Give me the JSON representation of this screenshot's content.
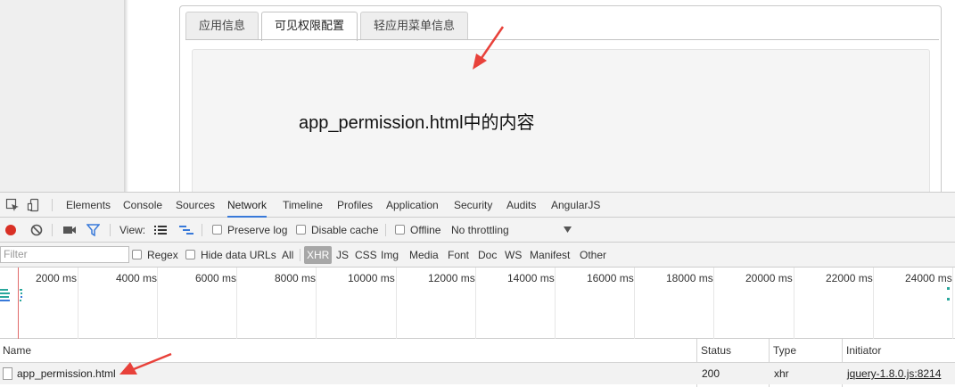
{
  "page": {
    "tabs": [
      {
        "label": "应用信息",
        "active": false
      },
      {
        "label": "可见权限配置",
        "active": true
      },
      {
        "label": "轻应用菜单信息",
        "active": false
      }
    ],
    "content_text": "app_permission.html中的内容"
  },
  "devtools": {
    "tabs": [
      "Elements",
      "Console",
      "Sources",
      "Network",
      "Timeline",
      "Profiles",
      "Application",
      "Security",
      "Audits",
      "AngularJS"
    ],
    "active_tab": "Network",
    "toolbar": {
      "view_label": "View:",
      "preserve_log": "Preserve log",
      "disable_cache": "Disable cache",
      "offline": "Offline",
      "throttling": "No throttling"
    },
    "filter": {
      "placeholder": "Filter",
      "regex": "Regex",
      "hide_data_urls": "Hide data URLs",
      "types": [
        "All",
        "XHR",
        "JS",
        "CSS",
        "Img",
        "Media",
        "Font",
        "Doc",
        "WS",
        "Manifest",
        "Other"
      ],
      "active_type": "XHR"
    },
    "timeline_ticks": [
      "2000 ms",
      "4000 ms",
      "6000 ms",
      "8000 ms",
      "10000 ms",
      "12000 ms",
      "14000 ms",
      "16000 ms",
      "18000 ms",
      "20000 ms",
      "22000 ms",
      "24000 ms"
    ],
    "columns": {
      "name": "Name",
      "status": "Status",
      "type": "Type",
      "initiator": "Initiator"
    },
    "rows": [
      {
        "name": "app_permission.html",
        "status": "200",
        "type": "xhr",
        "initiator": "jquery-1.8.0.js:8214"
      }
    ],
    "colors": {
      "accent": "#3879d9",
      "record": "#d93025",
      "annotation_arrow": "#e8413a"
    }
  }
}
